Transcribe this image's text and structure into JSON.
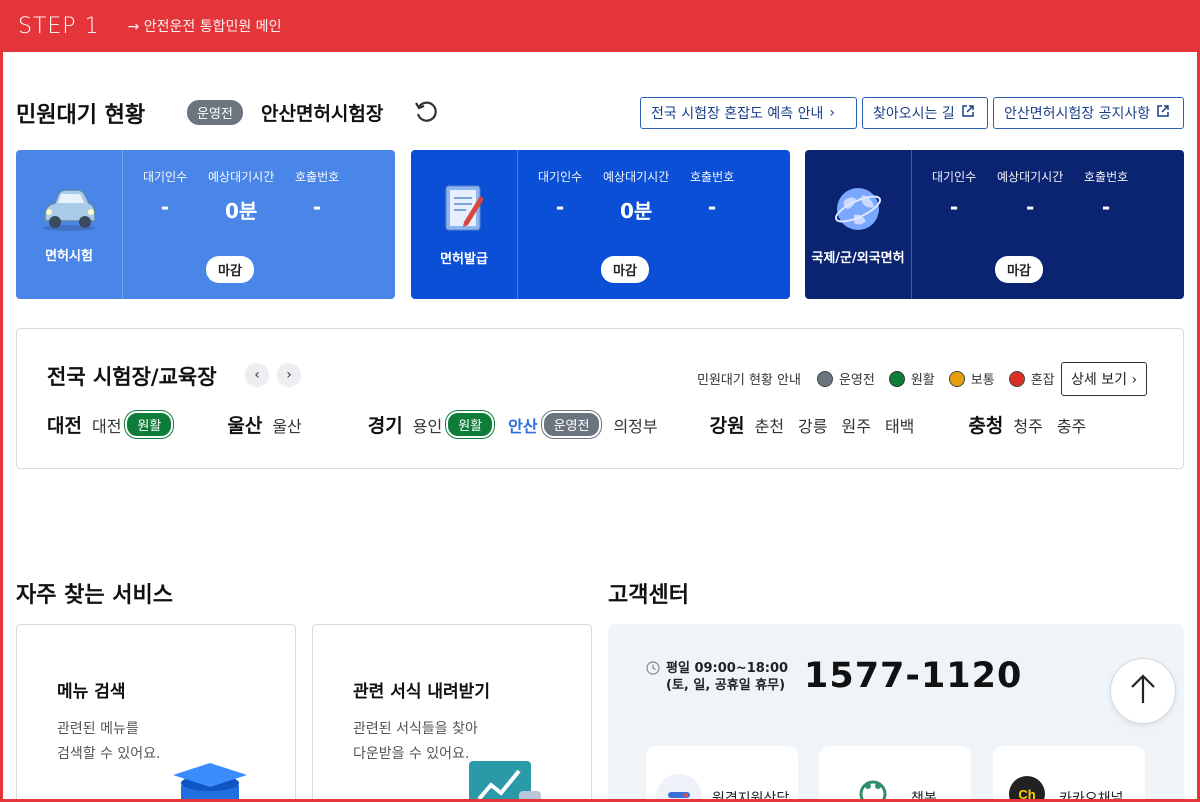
{
  "step": {
    "title": "STEP 1",
    "subtitle": "→ 안전운전 통합민원 메인"
  },
  "status": {
    "title": "민원대기 현황",
    "badge": "운영전",
    "site": "안산면허시험장",
    "links": [
      {
        "label": "전국 시험장 혼잡도 예측 안내"
      },
      {
        "label": "찾아오시는 길"
      },
      {
        "label": "안산면허시험장 공지사항"
      }
    ]
  },
  "wait_cards": [
    {
      "label": "면허시험",
      "bg": "#4a86e8",
      "icon": "car-icon",
      "waiting_key": "대기인수",
      "waiting": "-",
      "time_key": "예상대기시간",
      "time": "0분",
      "call_key": "호출번호",
      "call": "-",
      "state": "마감"
    },
    {
      "label": "면허발급",
      "bg": "#0a4fd6",
      "icon": "document-icon",
      "waiting_key": "대기인수",
      "waiting": "-",
      "time_key": "예상대기시간",
      "time": "0분",
      "call_key": "호출번호",
      "call": "-",
      "state": "마감"
    },
    {
      "label": "국제/군/외국면허",
      "bg": "#0b2472",
      "icon": "globe-icon",
      "waiting_key": "대기인수",
      "waiting": "-",
      "time_key": "예상대기시간",
      "time": "-",
      "call_key": "호출번호",
      "call": "-",
      "state": "마감"
    }
  ],
  "regions": {
    "title": "전국 시험장/교육장",
    "legend_title": "민원대기 현황 안내",
    "legend": [
      {
        "label": "운영전",
        "color": "#6c7480"
      },
      {
        "label": "원활",
        "color": "#0f7d3a"
      },
      {
        "label": "보통",
        "color": "#e6a00b"
      },
      {
        "label": "혼잡",
        "color": "#d93025"
      }
    ],
    "detail_label": "상세 보기",
    "groups": {
      "daejeon": {
        "name": "대전",
        "city1": "대전",
        "badge1": "원활"
      },
      "ulsan": {
        "name": "울산",
        "city1": "울산"
      },
      "gyeonggi": {
        "name": "경기",
        "city1": "용인",
        "badge1": "원활",
        "city2": "안산",
        "badge2": "운영전",
        "city3": "의정부"
      },
      "gangwon": {
        "name": "강원",
        "city1": "춘천",
        "city2": "강릉",
        "city3": "원주",
        "city4": "태백"
      },
      "chungcheong": {
        "name": "충청",
        "city1": "청주",
        "city2": "충주"
      }
    }
  },
  "services": {
    "title": "자주 찾는 서비스",
    "items": [
      {
        "title": "메뉴 검색",
        "desc": "관련된 메뉴를\n검색할 수 있어요."
      },
      {
        "title": "관련 서식 내려받기",
        "desc": "관련된 서식들을 찾아\n다운받을 수 있어요."
      }
    ]
  },
  "customer": {
    "title": "고객센터",
    "hours": "평일 09:00~18:00",
    "hours_note": "(토, 일, 공휴일 휴무)",
    "phone": "1577-1120",
    "channels": [
      {
        "label": "원격지원상담"
      },
      {
        "label": "챗봇"
      },
      {
        "label": "카카오채널"
      }
    ]
  }
}
